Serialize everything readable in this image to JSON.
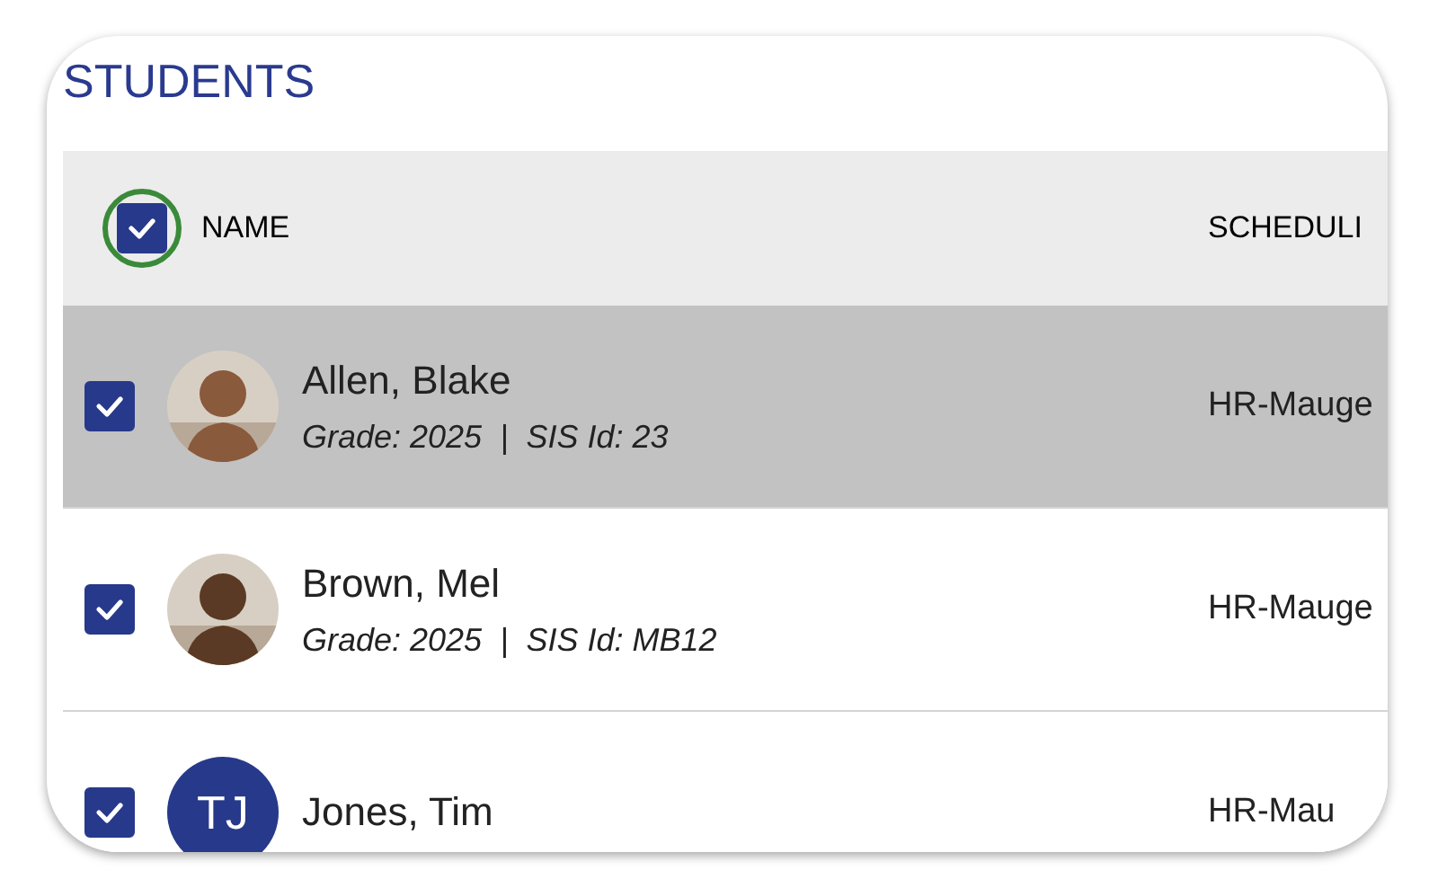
{
  "title": "STUDENTS",
  "table": {
    "select_all": {
      "checked": true,
      "focused": true
    },
    "columns": [
      "NAME",
      "SCHEDULI"
    ],
    "rows": [
      {
        "selected": true,
        "checked": true,
        "name": "Allen, Blake",
        "subtitle": "Grade: 2025  |  SIS Id: 23",
        "schedule": "HR-Mauge"
      },
      {
        "selected": false,
        "checked": true,
        "name": "Brown, Mel",
        "subtitle": "Grade: 2025  |  SIS Id: MB12",
        "schedule": "HR-Mauge"
      },
      {
        "selected": false,
        "checked": true,
        "avatar": {
          "kind": "initials",
          "initials": "TJ"
        },
        "name": "Jones, Tim",
        "schedule": "HR-Mau"
      }
    ]
  }
}
